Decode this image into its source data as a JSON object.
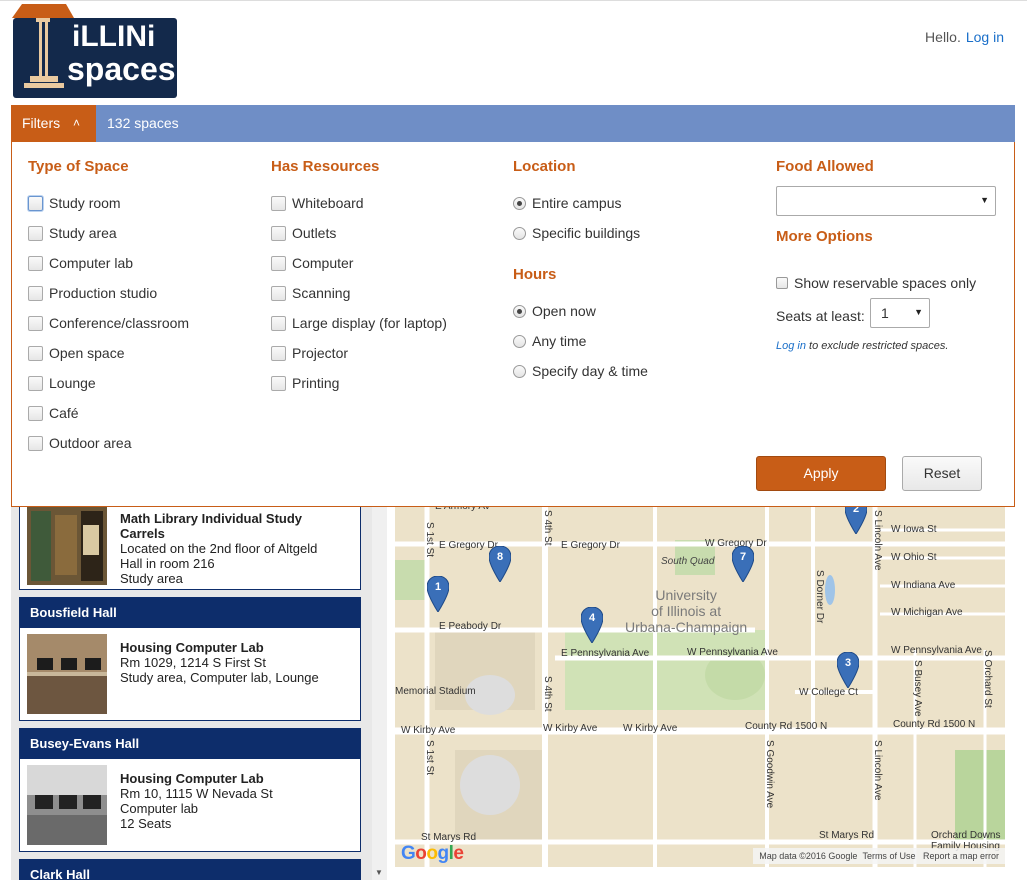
{
  "header": {
    "logo_text_top": "iLLINi",
    "logo_text_bottom": "spaces",
    "greeting": "Hello.",
    "login_link": "Log in"
  },
  "filter_bar": {
    "filters_label": "Filters",
    "count_label": "132 spaces"
  },
  "filters": {
    "type_of_space": {
      "heading": "Type of Space",
      "options": [
        "Study room",
        "Study area",
        "Computer lab",
        "Production studio",
        "Conference/classroom",
        "Open space",
        "Lounge",
        "Café",
        "Outdoor area"
      ]
    },
    "has_resources": {
      "heading": "Has Resources",
      "options": [
        "Whiteboard",
        "Outlets",
        "Computer",
        "Scanning",
        "Large display (for laptop)",
        "Projector",
        "Printing"
      ]
    },
    "location": {
      "heading": "Location",
      "options": [
        "Entire campus",
        "Specific buildings"
      ],
      "selected": "Entire campus"
    },
    "hours": {
      "heading": "Hours",
      "options": [
        "Open now",
        "Any time",
        "Specify day & time"
      ],
      "selected": "Open now"
    },
    "food_allowed": {
      "heading": "Food Allowed",
      "value": ""
    },
    "more_options": {
      "heading": "More Options",
      "reservable_label": "Show reservable spaces only",
      "seats_label": "Seats at least:",
      "seats_value": "1",
      "login_link": "Log in",
      "restricted_note": "to exclude restricted spaces."
    },
    "apply_label": "Apply",
    "reset_label": "Reset"
  },
  "results": [
    {
      "building": "",
      "title": "Math Library Individual Study Carrels",
      "lines": [
        "Located on the 2nd floor of Altgeld",
        "Hall in room 216",
        "Study area"
      ]
    },
    {
      "building": "Bousfield Hall",
      "title": "Housing Computer Lab",
      "lines": [
        "Rm 1029, 1214 S First St",
        "Study area, Computer lab, Lounge"
      ]
    },
    {
      "building": "Busey-Evans Hall",
      "title": "Housing Computer Lab",
      "lines": [
        "Rm 10, 1115 W Nevada St",
        "Computer lab",
        "12 Seats"
      ]
    },
    {
      "building": "Clark Hall",
      "title": "",
      "lines": []
    }
  ],
  "map": {
    "university_label": [
      "University",
      "of Illinois at",
      "Urbana-Champaign"
    ],
    "quad_label": "South Quad",
    "street_labels": [
      "E Armory Av",
      "E Gregory Dr",
      "E Gregory Dr",
      "W Gregory Dr",
      "E Peabody Dr",
      "E Pennsylvania Ave",
      "W Pennsylvania Ave",
      "W Pennsylvania Ave",
      "Memorial Stadium",
      "W College Ct",
      "W Kirby Ave",
      "W Kirby Ave",
      "W Kirby Ave",
      "County Rd 1500 N",
      "County Rd 1500 N",
      "St Marys Rd",
      "St Marys Rd",
      "W Iowa St",
      "W Ohio St",
      "W Indiana Ave",
      "W Michigan Ave",
      "S 1st St",
      "S 1st St",
      "S 4th St",
      "S 4th St",
      "S Dorner Dr",
      "S Lincoln Ave",
      "S Lincoln Ave",
      "S Goodwin Ave",
      "S Busey Ave",
      "S Orchard St",
      "Orchard Downs Family Housing"
    ],
    "pins": [
      "1",
      "8",
      "4",
      "7",
      "3",
      "2"
    ],
    "google_label": "Google",
    "footer": [
      "Map data ©2016 Google",
      "Terms of Use",
      "Report a map error"
    ]
  },
  "colors": {
    "accent_orange": "#c85d17",
    "bar_blue": "#6f8ec6",
    "navy": "#0d2d6b",
    "link_blue": "#1a6fc9"
  }
}
